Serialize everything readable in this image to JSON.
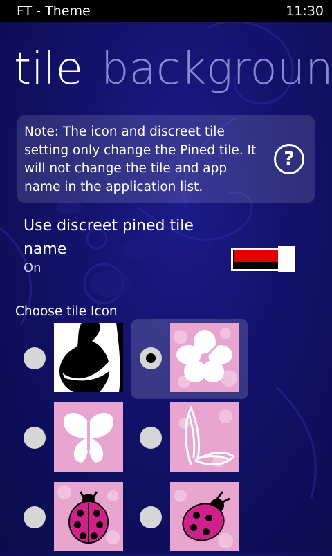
{
  "status_bar": {
    "app_title": "FT - Theme",
    "time": "11:30"
  },
  "pivot": {
    "active": "tile",
    "next": "background"
  },
  "note": {
    "text": "Note: The icon and discreet tile setting only change the Pined tile. It will not change the tile and app name in the application list.",
    "help_label": "?"
  },
  "discreet_toggle": {
    "label": "Use discreet pined tile name",
    "state_text": "On",
    "is_on": true
  },
  "tile_icons": {
    "title": "Choose tile Icon",
    "selected_index": 1,
    "options": [
      {
        "icon": "pregnant-silhouette-icon"
      },
      {
        "icon": "hibiscus-flower-icon"
      },
      {
        "icon": "butterfly-icon"
      },
      {
        "icon": "lace-butterfly-icon"
      },
      {
        "icon": "ladybug-icon"
      },
      {
        "icon": "pink-ladybug-icon"
      }
    ]
  },
  "colors": {
    "background": "#12126a",
    "toggle_on": "#e00000",
    "tile_pink": "#e8a5d0",
    "pivot_inactive": "#8a88d0"
  }
}
